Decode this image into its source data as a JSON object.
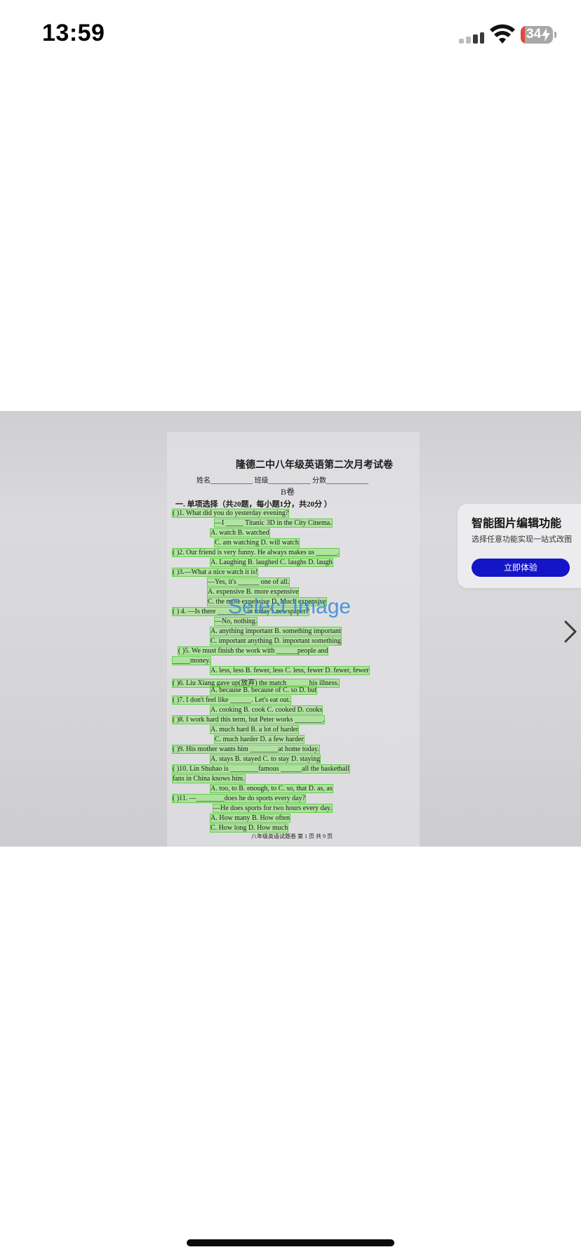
{
  "status_bar": {
    "time": "13:59",
    "battery_percent": "34"
  },
  "document": {
    "title": "隆德二中八年级英语第二次月考试卷",
    "fields": "姓名____________  班级____________  分数____________",
    "section": "B卷",
    "question_header": "一. 单项选择（共20题，每小题1分，共20分 ）",
    "lines": [
      "(     )1. What did you do yesterday evening?",
      "—I _____ Titanic 3D in the City Cinema.",
      "A. watch                    B. watched",
      "C. am watching              D. will watch",
      "(     )2. Our friend is very funny. He always makes us ______.",
      "A. Laughing        B. laughed        C. laughs        D. laugh",
      "(     )3.—What a nice watch it is!",
      "—Yes, it's ______ one of all.",
      "A. expensive              B. more expensive",
      "C. the most expensive     D. Much expensive",
      "(     ) 4. —Is there ________ in today's newspaper?",
      "—No, nothing.",
      "A. anything important     B. something important",
      "C. important anything     D. important something",
      "(     )5. We must finish the work with ______people and",
      "_____money.",
      "A. less, less  B. fewer, less  C. less, fewer  D. fewer, fewer",
      "(     )6. Liu Xiang gave up(放弃) the match______ his illness.",
      "A. because   B. because of    C. so      D. but",
      "(     )7. I don't feel like ______. Let's eat out.",
      "A. cooking    B. cook      C. cooked      D. cooks",
      "(     )8. I work hard this term, but Peter works ________.",
      "A. much hard               B. a lot of harder",
      "C. much harder             D. a few harder",
      "(     )9. His mother wants him ________at home today.",
      "A. stays     B. stayed      C. to stay     D. staying",
      "(     )10. Lin Shuhao is ________famous ______all the basketball",
      "fans in China knows him.",
      "A. too, to     B. enough, to      C. so, that      D. as, as",
      "(     )11. —________does he do sports every day?",
      "—He does sports for two hours every day.",
      "A. How many               B. How often",
      "C. How long               D. How much"
    ],
    "footer": "八年级英语试题卷   第 1 页 共 9 页"
  },
  "overlay": {
    "select_image_label": "Select Image",
    "promo_title": "智能图片编辑功能",
    "promo_subtitle": "选择任意功能实现一站式改图",
    "promo_button": "立即体验"
  },
  "icons": [
    "signal-icon",
    "wifi-icon",
    "battery-icon",
    "chevron-right-icon"
  ]
}
